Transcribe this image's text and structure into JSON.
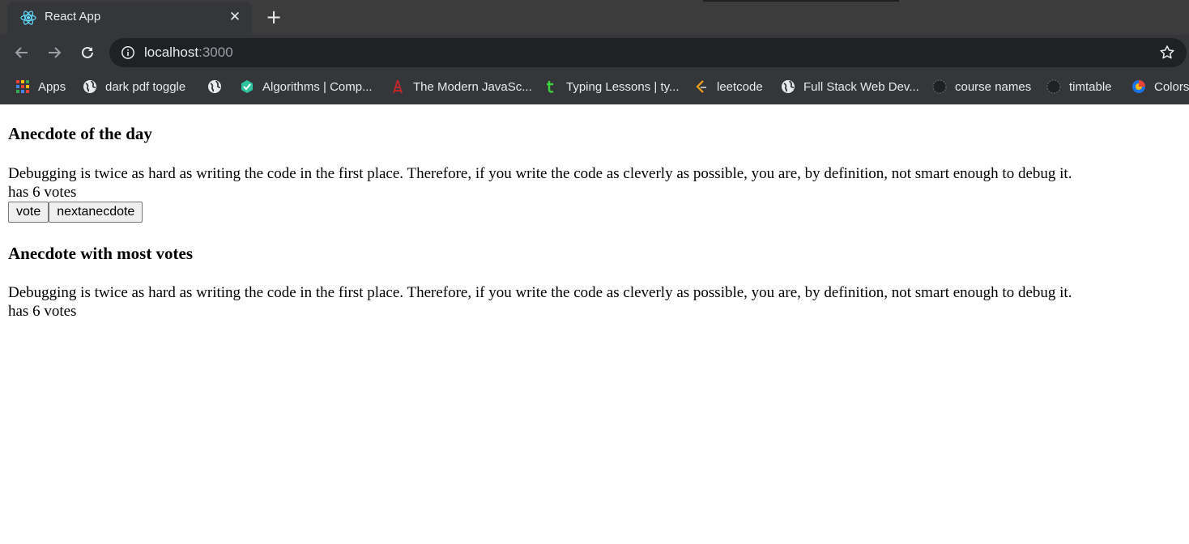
{
  "browser": {
    "tab": {
      "title": "React App",
      "close_label": "✕"
    },
    "new_tab_label": "+",
    "address": {
      "host": "localhost",
      "port": ":3000"
    },
    "bookmarks": [
      {
        "label": "Apps",
        "icon": "apps-grid-icon"
      },
      {
        "label": "dark pdf toggle",
        "icon": "globe-icon"
      },
      {
        "label": "",
        "icon": "globe-icon"
      },
      {
        "label": "Algorithms | Comp...",
        "icon": "geeks-icon"
      },
      {
        "label": "The Modern JavaSc...",
        "icon": "tower-icon"
      },
      {
        "label": "Typing Lessons | ty...",
        "icon": "typing-icon"
      },
      {
        "label": "leetcode",
        "icon": "leetcode-icon"
      },
      {
        "label": "Full Stack Web Dev...",
        "icon": "globe-icon"
      },
      {
        "label": "course names",
        "icon": "github-icon"
      },
      {
        "label": "timtable",
        "icon": "github-icon"
      },
      {
        "label": "Colors",
        "icon": "colors-icon"
      }
    ]
  },
  "app": {
    "day_heading": "Anecdote of the day",
    "day_anecdote": "Debugging is twice as hard as writing the code in the first place. Therefore, if you write the code as cleverly as possible, you are, by definition, not smart enough to debug it.",
    "day_votes": "has 6 votes",
    "vote_label": "vote",
    "next_label": "nextanecdote",
    "most_heading": "Anecdote with most votes",
    "most_anecdote": "Debugging is twice as hard as writing the code in the first place. Therefore, if you write the code as cleverly as possible, you are, by definition, not smart enough to debug it.",
    "most_votes": "has 6 votes"
  }
}
